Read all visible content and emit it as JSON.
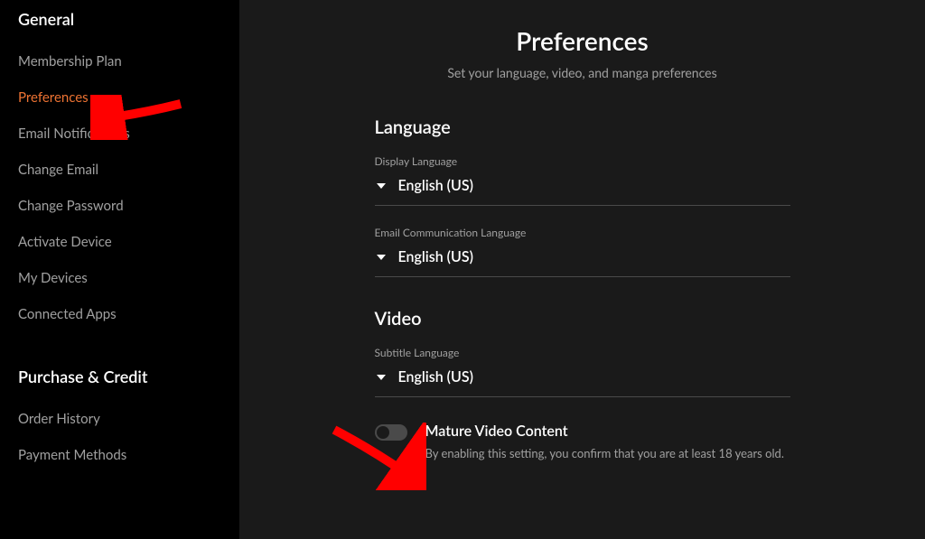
{
  "sidebar": {
    "section1_title": "General",
    "items1": [
      {
        "label": "Membership Plan",
        "active": false
      },
      {
        "label": "Preferences",
        "active": true
      },
      {
        "label": "Email Notifications",
        "active": false
      },
      {
        "label": "Change Email",
        "active": false
      },
      {
        "label": "Change Password",
        "active": false
      },
      {
        "label": "Activate Device",
        "active": false
      },
      {
        "label": "My Devices",
        "active": false
      },
      {
        "label": "Connected Apps",
        "active": false
      }
    ],
    "section2_title": "Purchase & Credit",
    "items2": [
      {
        "label": "Order History",
        "active": false
      },
      {
        "label": "Payment Methods",
        "active": false
      }
    ]
  },
  "main": {
    "title": "Preferences",
    "subtitle": "Set your language, video, and manga preferences",
    "language_section": {
      "header": "Language",
      "display_language": {
        "label": "Display Language",
        "value": "English (US)"
      },
      "email_language": {
        "label": "Email Communication Language",
        "value": "English (US)"
      }
    },
    "video_section": {
      "header": "Video",
      "subtitle_language": {
        "label": "Subtitle Language",
        "value": "English (US)"
      },
      "mature": {
        "title": "Mature Video Content",
        "description": "By enabling this setting, you confirm that you are at least 18 years old.",
        "enabled": false
      }
    }
  },
  "colors": {
    "accent": "#ec7232",
    "bg_sidebar": "#000000",
    "bg_main": "#1a1a1a",
    "text_muted": "#a0a0a0",
    "annotation": "#ff0000"
  }
}
